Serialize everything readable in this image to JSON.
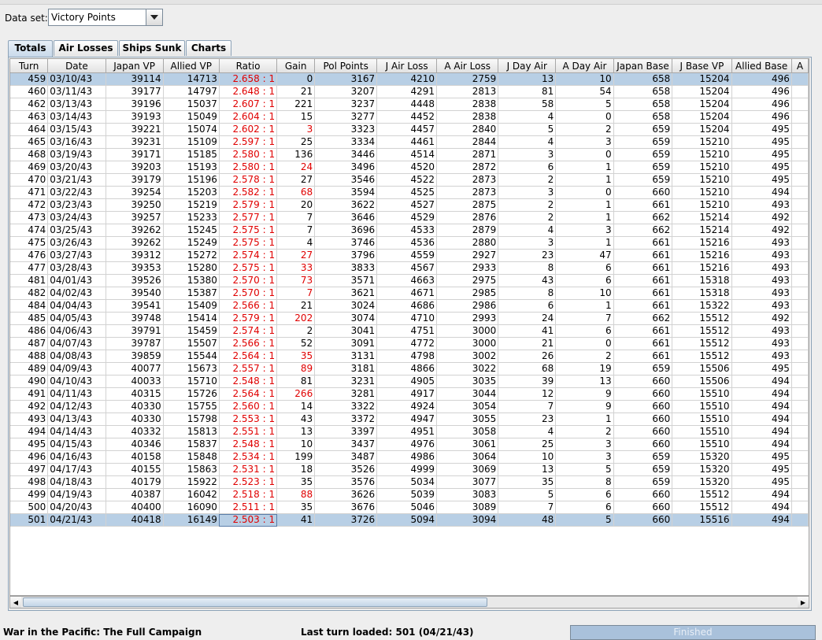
{
  "dataset": {
    "label": "Data set:",
    "selected": "Victory Points"
  },
  "tabs": [
    {
      "label": "Totals",
      "active": true
    },
    {
      "label": "Air Losses",
      "active": false
    },
    {
      "label": "Ships Sunk",
      "active": false
    },
    {
      "label": "Charts",
      "active": false
    }
  ],
  "table": {
    "columns": [
      "Turn",
      "Date",
      "Japan VP",
      "Allied VP",
      "Ratio",
      "Gain",
      "Pol Points",
      "J Air Loss",
      "A Air Loss",
      "J Day Air",
      "A Day Air",
      "Japan Base",
      "J Base VP",
      "Allied Base",
      "A"
    ],
    "rows": [
      [
        "459",
        "03/10/43",
        "39114",
        "14713",
        "2.658 : 1",
        "0",
        "3167",
        "4210",
        "2759",
        "13",
        "10",
        "658",
        "15204",
        "496"
      ],
      [
        "460",
        "03/11/43",
        "39177",
        "14797",
        "2.648 : 1",
        "21",
        "3207",
        "4291",
        "2813",
        "81",
        "54",
        "658",
        "15204",
        "496"
      ],
      [
        "462",
        "03/13/43",
        "39196",
        "15037",
        "2.607 : 1",
        "221",
        "3237",
        "4448",
        "2838",
        "58",
        "5",
        "658",
        "15204",
        "496"
      ],
      [
        "463",
        "03/14/43",
        "39193",
        "15049",
        "2.604 : 1",
        "15",
        "3277",
        "4452",
        "2838",
        "4",
        "0",
        "658",
        "15204",
        "496"
      ],
      [
        "464",
        "03/15/43",
        "39221",
        "15074",
        "2.602 : 1",
        "3",
        "3323",
        "4457",
        "2840",
        "5",
        "2",
        "659",
        "15204",
        "495"
      ],
      [
        "465",
        "03/16/43",
        "39231",
        "15109",
        "2.597 : 1",
        "25",
        "3334",
        "4461",
        "2844",
        "4",
        "3",
        "659",
        "15210",
        "495"
      ],
      [
        "468",
        "03/19/43",
        "39171",
        "15185",
        "2.580 : 1",
        "136",
        "3446",
        "4514",
        "2871",
        "3",
        "0",
        "659",
        "15210",
        "495"
      ],
      [
        "469",
        "03/20/43",
        "39203",
        "15193",
        "2.580 : 1",
        "24",
        "3496",
        "4520",
        "2872",
        "6",
        "1",
        "659",
        "15210",
        "495"
      ],
      [
        "470",
        "03/21/43",
        "39179",
        "15196",
        "2.578 : 1",
        "27",
        "3546",
        "4522",
        "2873",
        "2",
        "1",
        "659",
        "15210",
        "495"
      ],
      [
        "471",
        "03/22/43",
        "39254",
        "15203",
        "2.582 : 1",
        "68",
        "3594",
        "4525",
        "2873",
        "3",
        "0",
        "660",
        "15210",
        "494"
      ],
      [
        "472",
        "03/23/43",
        "39250",
        "15219",
        "2.579 : 1",
        "20",
        "3622",
        "4527",
        "2875",
        "2",
        "1",
        "661",
        "15210",
        "493"
      ],
      [
        "473",
        "03/24/43",
        "39257",
        "15233",
        "2.577 : 1",
        "7",
        "3646",
        "4529",
        "2876",
        "2",
        "1",
        "662",
        "15214",
        "492"
      ],
      [
        "474",
        "03/25/43",
        "39262",
        "15245",
        "2.575 : 1",
        "7",
        "3696",
        "4533",
        "2879",
        "4",
        "3",
        "662",
        "15214",
        "492"
      ],
      [
        "475",
        "03/26/43",
        "39262",
        "15249",
        "2.575 : 1",
        "4",
        "3746",
        "4536",
        "2880",
        "3",
        "1",
        "661",
        "15216",
        "493"
      ],
      [
        "476",
        "03/27/43",
        "39312",
        "15272",
        "2.574 : 1",
        "27",
        "3796",
        "4559",
        "2927",
        "23",
        "47",
        "661",
        "15216",
        "493"
      ],
      [
        "477",
        "03/28/43",
        "39353",
        "15280",
        "2.575 : 1",
        "33",
        "3833",
        "4567",
        "2933",
        "8",
        "6",
        "661",
        "15216",
        "493"
      ],
      [
        "481",
        "04/01/43",
        "39526",
        "15380",
        "2.570 : 1",
        "73",
        "3571",
        "4663",
        "2975",
        "43",
        "6",
        "661",
        "15318",
        "493"
      ],
      [
        "482",
        "04/02/43",
        "39540",
        "15387",
        "2.570 : 1",
        "7",
        "3621",
        "4671",
        "2985",
        "8",
        "10",
        "661",
        "15318",
        "493"
      ],
      [
        "484",
        "04/04/43",
        "39541",
        "15409",
        "2.566 : 1",
        "21",
        "3024",
        "4686",
        "2986",
        "6",
        "1",
        "661",
        "15322",
        "493"
      ],
      [
        "485",
        "04/05/43",
        "39748",
        "15414",
        "2.579 : 1",
        "202",
        "3074",
        "4710",
        "2993",
        "24",
        "7",
        "662",
        "15512",
        "492"
      ],
      [
        "486",
        "04/06/43",
        "39791",
        "15459",
        "2.574 : 1",
        "2",
        "3041",
        "4751",
        "3000",
        "41",
        "6",
        "661",
        "15512",
        "493"
      ],
      [
        "487",
        "04/07/43",
        "39787",
        "15507",
        "2.566 : 1",
        "52",
        "3091",
        "4772",
        "3000",
        "21",
        "0",
        "661",
        "15512",
        "493"
      ],
      [
        "488",
        "04/08/43",
        "39859",
        "15544",
        "2.564 : 1",
        "35",
        "3131",
        "4798",
        "3002",
        "26",
        "2",
        "661",
        "15512",
        "493"
      ],
      [
        "489",
        "04/09/43",
        "40077",
        "15673",
        "2.557 : 1",
        "89",
        "3181",
        "4866",
        "3022",
        "68",
        "19",
        "659",
        "15506",
        "495"
      ],
      [
        "490",
        "04/10/43",
        "40033",
        "15710",
        "2.548 : 1",
        "81",
        "3231",
        "4905",
        "3035",
        "39",
        "13",
        "660",
        "15506",
        "494"
      ],
      [
        "491",
        "04/11/43",
        "40315",
        "15726",
        "2.564 : 1",
        "266",
        "3281",
        "4917",
        "3044",
        "12",
        "9",
        "660",
        "15510",
        "494"
      ],
      [
        "492",
        "04/12/43",
        "40330",
        "15755",
        "2.560 : 1",
        "14",
        "3322",
        "4924",
        "3054",
        "7",
        "9",
        "660",
        "15510",
        "494"
      ],
      [
        "493",
        "04/13/43",
        "40330",
        "15798",
        "2.553 : 1",
        "43",
        "3372",
        "4947",
        "3055",
        "23",
        "1",
        "660",
        "15510",
        "494"
      ],
      [
        "494",
        "04/14/43",
        "40332",
        "15813",
        "2.551 : 1",
        "13",
        "3397",
        "4951",
        "3058",
        "4",
        "2",
        "660",
        "15510",
        "494"
      ],
      [
        "495",
        "04/15/43",
        "40346",
        "15837",
        "2.548 : 1",
        "10",
        "3437",
        "4976",
        "3061",
        "25",
        "3",
        "660",
        "15510",
        "494"
      ],
      [
        "496",
        "04/16/43",
        "40158",
        "15848",
        "2.534 : 1",
        "199",
        "3487",
        "4986",
        "3064",
        "10",
        "3",
        "659",
        "15320",
        "495"
      ],
      [
        "497",
        "04/17/43",
        "40155",
        "15863",
        "2.531 : 1",
        "18",
        "3526",
        "4999",
        "3069",
        "13",
        "5",
        "659",
        "15320",
        "495"
      ],
      [
        "498",
        "04/18/43",
        "40179",
        "15922",
        "2.523 : 1",
        "35",
        "3576",
        "5034",
        "3077",
        "35",
        "8",
        "659",
        "15320",
        "495"
      ],
      [
        "499",
        "04/19/43",
        "40387",
        "16042",
        "2.518 : 1",
        "88",
        "3626",
        "5039",
        "3083",
        "5",
        "6",
        "660",
        "15512",
        "494"
      ],
      [
        "500",
        "04/20/43",
        "40400",
        "16090",
        "2.511 : 1",
        "35",
        "3676",
        "5046",
        "3089",
        "7",
        "6",
        "660",
        "15512",
        "494"
      ],
      [
        "501",
        "04/21/43",
        "40418",
        "16149",
        "2.503 : 1",
        "41",
        "3726",
        "5094",
        "3094",
        "48",
        "5",
        "660",
        "15516",
        "494"
      ]
    ],
    "red_gain_rows": [
      4,
      7,
      9,
      14,
      15,
      16,
      17,
      19,
      22,
      23,
      25,
      33
    ],
    "selected_rows": [
      0,
      35
    ],
    "red_color": "#e00000",
    "selection_color": "#b8cfe5"
  },
  "status": {
    "game": "War in the Pacific: The Full Campaign",
    "last_turn": "Last turn loaded: 501 (04/21/43)",
    "progress_label": "Finished",
    "progress": 1.0
  }
}
